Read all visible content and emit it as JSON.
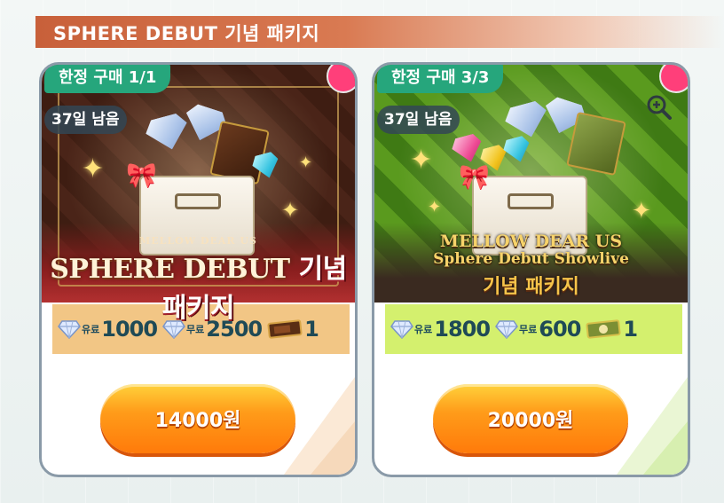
{
  "header": {
    "title": "SPHERE DEBUT 기념 패키지"
  },
  "cards": [
    {
      "limit_label": "한정 구매 1/1",
      "days_label": "37일 남음",
      "logo": {
        "sub": "MELLOW DEAR US",
        "main": "SPHERE DEBUT",
        "kr": "기념 패키지"
      },
      "contents": [
        {
          "icon": "diamond-icon",
          "label": "유료",
          "value": "1000"
        },
        {
          "icon": "diamond-icon",
          "label": "무료",
          "value": "2500"
        },
        {
          "icon": "chocolate-ticket-icon",
          "label": "",
          "value": "1"
        }
      ],
      "price": "14000원"
    },
    {
      "limit_label": "한정 구매 3/3",
      "days_label": "37일 남음",
      "logo": {
        "l1": "MELLOW DEAR US",
        "l2": "Sphere Debut Showlive",
        "l3": "기념 패키지"
      },
      "contents": [
        {
          "icon": "diamond-icon",
          "label": "유료",
          "value": "1800"
        },
        {
          "icon": "diamond-icon",
          "label": "무료",
          "value": "600"
        },
        {
          "icon": "green-ticket-icon",
          "label": "",
          "value": "1"
        }
      ],
      "price": "20000원"
    }
  ],
  "colors": {
    "header": "#c8603a",
    "limit_tag": "#26a67c",
    "notification_dot": "#ff3f7a",
    "price_button": "#ff9c1a"
  }
}
